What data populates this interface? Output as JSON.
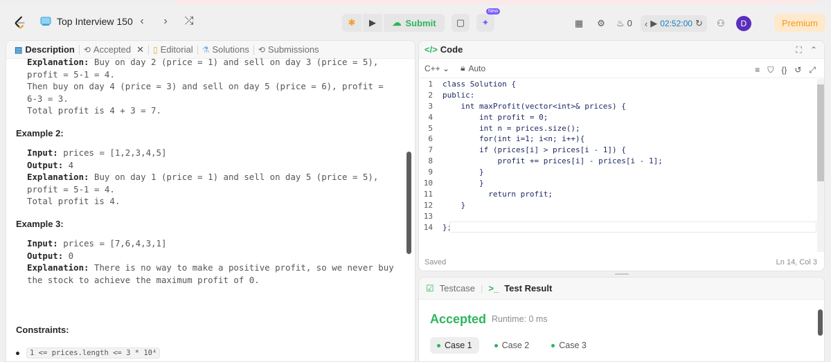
{
  "topnav": {
    "problem_list_label": "Top Interview 150",
    "submit_label": "Submit",
    "new_badge": "New",
    "streak_count": "0",
    "timer": "02:52:00",
    "avatar_letter": "D",
    "premium_label": "Premium"
  },
  "left_tabs": {
    "description": "Description",
    "accepted": "Accepted",
    "editorial": "Editorial",
    "solutions": "Solutions",
    "submissions": "Submissions"
  },
  "description": {
    "ex1_lines": {
      "explanation_label": "Explanation:",
      "line1": " Buy on day 2 (price = 1) and sell on day 3 (price = 5),",
      "line2": "profit = 5-1 = 4.",
      "line3": "Then buy on day 4 (price = 3) and sell on day 5 (price = 6), profit =",
      "line4": "6-3 = 3.",
      "line5": "Total profit is 4 + 3 = 7."
    },
    "example2": {
      "title": "Example 2:",
      "input_label": "Input:",
      "input_value": " prices = [1,2,3,4,5]",
      "output_label": "Output:",
      "output_value": " 4",
      "explanation_label": "Explanation:",
      "line1": " Buy on day 1 (price = 1) and sell on day 5 (price = 5),",
      "line2": "profit = 5-1 = 4.",
      "line3": "Total profit is 4."
    },
    "example3": {
      "title": "Example 3:",
      "input_label": "Input:",
      "input_value": " prices = [7,6,4,3,1]",
      "output_label": "Output:",
      "output_value": " 0",
      "explanation_label": "Explanation:",
      "line1": " There is no way to make a positive profit, so we never buy",
      "line2": "the stock to achieve the maximum profit of 0."
    },
    "constraints_title": "Constraints:",
    "constraint1": "1 <= prices.length <= 3 * 10⁴"
  },
  "code_panel": {
    "title": "Code",
    "language": "C++",
    "mode": "Auto",
    "status_left": "Saved",
    "status_right": "Ln 14, Col 3",
    "lines": [
      {
        "n": "1",
        "code": "class Solution {"
      },
      {
        "n": "2",
        "code": "public:"
      },
      {
        "n": "3",
        "code": "    int maxProfit(vector<int>& prices) {"
      },
      {
        "n": "4",
        "code": "        int profit = 0;"
      },
      {
        "n": "5",
        "code": "        int n = prices.size();"
      },
      {
        "n": "6",
        "code": "        for(int i=1; i<n; i++){"
      },
      {
        "n": "7",
        "code": "        if (prices[i] > prices[i - 1]) {"
      },
      {
        "n": "8",
        "code": "            profit += prices[i] - prices[i - 1];"
      },
      {
        "n": "9",
        "code": "        }"
      },
      {
        "n": "10",
        "code": "        }"
      },
      {
        "n": "11",
        "code": "          return profit;"
      },
      {
        "n": "12",
        "code": "    }"
      },
      {
        "n": "13",
        "code": ""
      },
      {
        "n": "14",
        "code": "};"
      }
    ]
  },
  "test_panel": {
    "testcase_tab": "Testcase",
    "result_tab": "Test Result",
    "term_icon": ">_",
    "verdict": "Accepted",
    "runtime": "Runtime: 0 ms",
    "cases": [
      "Case 1",
      "Case 2",
      "Case 3"
    ]
  },
  "colors": {
    "accent_green": "#2db55d",
    "premium_orange": "#ef9b1d",
    "timer_blue": "#1a7cc0"
  }
}
